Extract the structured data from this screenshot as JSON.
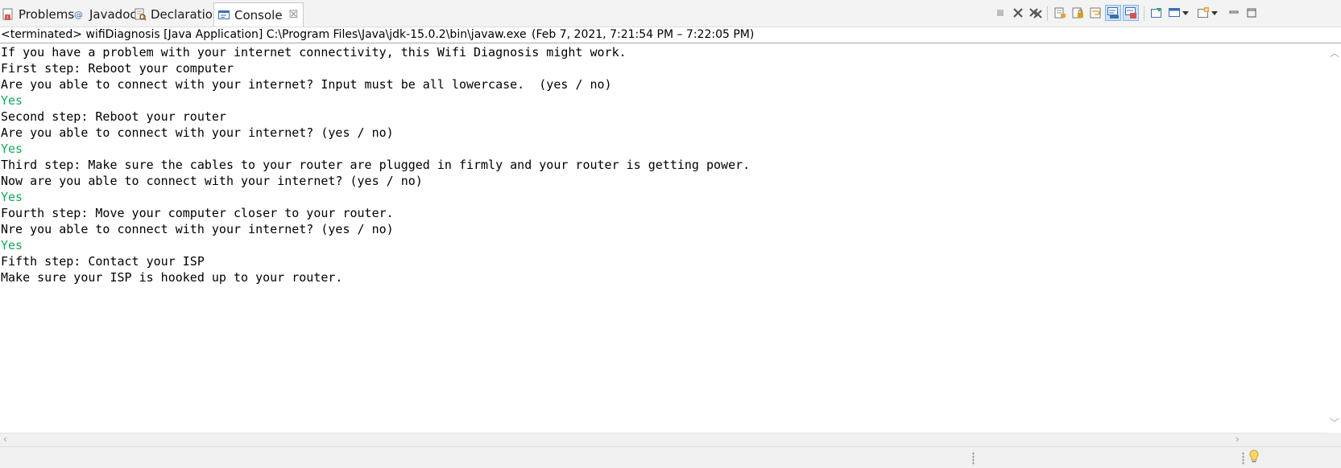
{
  "tabs": [
    {
      "label": "Problems",
      "icon": "problems-icon"
    },
    {
      "label": "Javadoc",
      "icon": "javadoc-icon"
    },
    {
      "label": "Declaration",
      "icon": "declaration-icon"
    },
    {
      "label": "Console",
      "icon": "console-icon",
      "active": true,
      "close_glyph": "☒"
    }
  ],
  "toolbar": {
    "buttons": [
      "terminate-icon",
      "remove-launch-icon",
      "remove-all-terminated-icon",
      "clear-console-icon",
      "scroll-lock-icon",
      "word-wrap-icon",
      "show-on-stdout-icon",
      "show-on-stderr-icon",
      "pin-console-icon",
      "display-selected-console-icon",
      "open-console-icon",
      "minimize-icon",
      "maximize-icon"
    ]
  },
  "process": {
    "status": "<terminated>",
    "name": "wifiDiagnosis",
    "type": "[Java Application]",
    "path": "C:\\Program Files\\Java\\jdk-15.0.2\\bin\\javaw.exe",
    "time": "(Feb 7, 2021, 7:21:54 PM – 7:22:05 PM)"
  },
  "console": {
    "lines": [
      {
        "text": "If you have a problem with your internet connectivity, this Wifi Diagnosis might work.",
        "kind": "output"
      },
      {
        "text": "First step: Reboot your computer",
        "kind": "output"
      },
      {
        "text": "Are you able to connect with your internet? Input must be all lowercase.  (yes / no)",
        "kind": "output"
      },
      {
        "text": "Yes",
        "kind": "input"
      },
      {
        "text": "Second step: Reboot your router",
        "kind": "output"
      },
      {
        "text": "Are you able to connect with your internet? (yes / no)",
        "kind": "output"
      },
      {
        "text": "Yes",
        "kind": "input"
      },
      {
        "text": "Third step: Make sure the cables to your router are plugged in firmly and your router is getting power.",
        "kind": "output"
      },
      {
        "text": "Now are you able to connect with your internet? (yes / no)",
        "kind": "output"
      },
      {
        "text": "Yes",
        "kind": "input"
      },
      {
        "text": "Fourth step: Move your computer closer to your router.",
        "kind": "output"
      },
      {
        "text": "Nre you able to connect with your internet? (yes / no)",
        "kind": "output"
      },
      {
        "text": "Yes",
        "kind": "input"
      },
      {
        "text": "Fifth step: Contact your ISP",
        "kind": "output"
      },
      {
        "text": "Make sure your ISP is hooked up to your router.",
        "kind": "output"
      }
    ]
  },
  "colors": {
    "input_text": "#17a65a",
    "active_tab_bg": "#ffffff",
    "tabbar_bg": "#f3f3f3",
    "pressed_button_bg": "#cfe3f7"
  }
}
